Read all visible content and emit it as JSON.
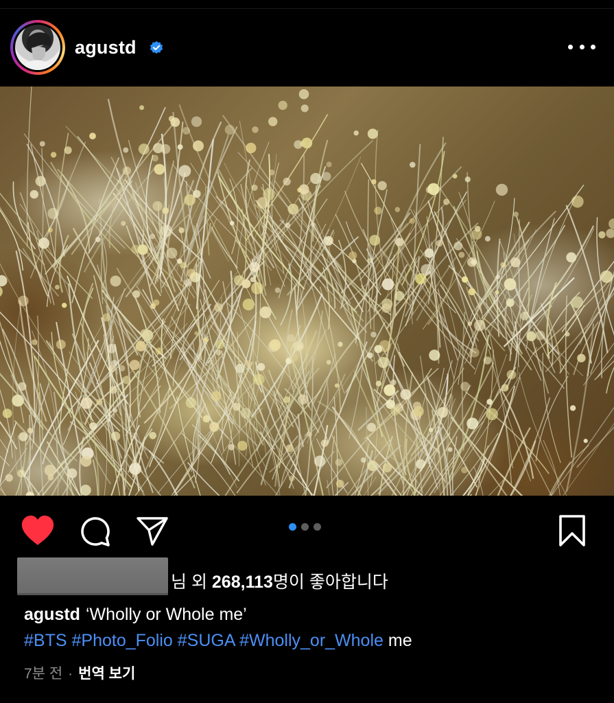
{
  "post": {
    "username": "agustd",
    "verified_icon": "verified-badge-icon",
    "more_icon": "more-options-icon",
    "accent_blue": "#2f8ff3",
    "heart_color": "#ff3040",
    "carousel": {
      "count": 3,
      "active_index": 0
    },
    "likes": {
      "suffix_1": "님 외 ",
      "count": "268,113",
      "suffix_2": "명이 좋아합니다"
    },
    "caption": {
      "username": "agustd",
      "text": "‘Wholly or Whole me’"
    },
    "hashtags": [
      "#BTS",
      "#Photo_Folio",
      "#SUGA",
      "#Wholly_or_Whole"
    ],
    "hashtag_trailing": " me",
    "meta": {
      "time": "7분 전",
      "separator": "·",
      "translate": "번역 보기"
    }
  }
}
